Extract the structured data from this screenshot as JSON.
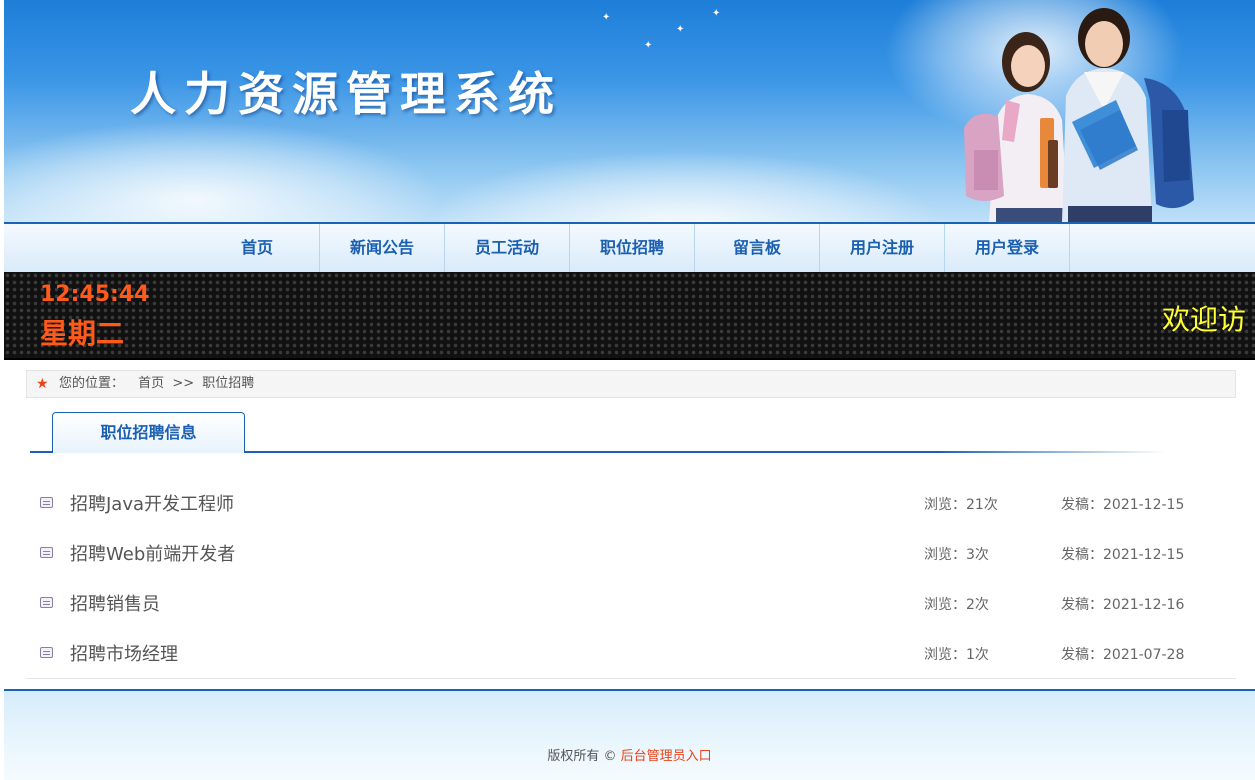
{
  "header": {
    "title": "人力资源管理系统"
  },
  "nav": {
    "items": [
      {
        "label": "首页"
      },
      {
        "label": "新闻公告"
      },
      {
        "label": "员工活动"
      },
      {
        "label": "职位招聘"
      },
      {
        "label": "留言板"
      },
      {
        "label": "用户注册"
      },
      {
        "label": "用户登录"
      }
    ]
  },
  "ticker": {
    "time": "12:45:44",
    "day": "星期二",
    "message": "欢迎访"
  },
  "breadcrumb": {
    "prefix": "您的位置：",
    "home": "首页",
    "separator": ">>",
    "current": "职位招聘"
  },
  "tab": {
    "label": "职位招聘信息"
  },
  "jobs": [
    {
      "title": "招聘Java开发工程师",
      "views": "浏览：21次",
      "date": "发稿：2021-12-15"
    },
    {
      "title": "招聘Web前端开发者",
      "views": "浏览：3次",
      "date": "发稿：2021-12-15"
    },
    {
      "title": "招聘销售员",
      "views": "浏览：2次",
      "date": "发稿：2021-12-16"
    },
    {
      "title": "招聘市场经理",
      "views": "浏览：1次",
      "date": "发稿：2021-07-28"
    }
  ],
  "footer": {
    "copyright": "版权所有 ©",
    "admin_link": "后台管理员入口"
  },
  "colors": {
    "brand_blue": "#1a62b5",
    "accent_orange": "#e8431a",
    "led_orange": "#ff5a1a",
    "led_yellow": "#ffff33"
  },
  "icons": {
    "breadcrumb": "star-icon",
    "job_row": "document-icon"
  }
}
